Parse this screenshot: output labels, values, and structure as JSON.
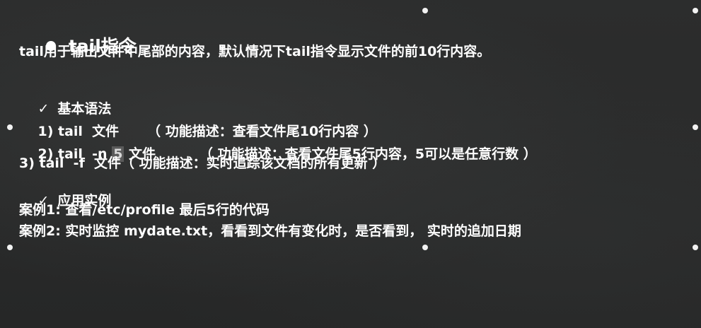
{
  "title": "tail指令",
  "intro": "tail用于输出文件中尾部的内容，默认情况下tail指令显示文件的前10行内容。",
  "syntax": {
    "heading": "基本语法",
    "item1_cmd": "1) tail  文件",
    "item1_desc": "（ 功能描述：查看文件尾10行内容 ）",
    "item2_cmd_prefix": "2) tail  -n ",
    "item2_num": "5",
    "item2_cmd_suffix": " 文件",
    "item2_desc": "（ 功能描述：查看文件尾5行内容，5可以是任意行数 ）",
    "item3": "3) tail  -f  文件（ 功能描述：实时追踪该文档的所有更新 ）"
  },
  "examples": {
    "heading": "应用实例",
    "case1": "案例1: 查看/etc/profile 最后5行的代码",
    "case2": "案例2: 实时监控 mydate.txt，看看到文件有变化时，是否看到， 实时的追加日期"
  },
  "icons": {
    "check": "✓"
  }
}
